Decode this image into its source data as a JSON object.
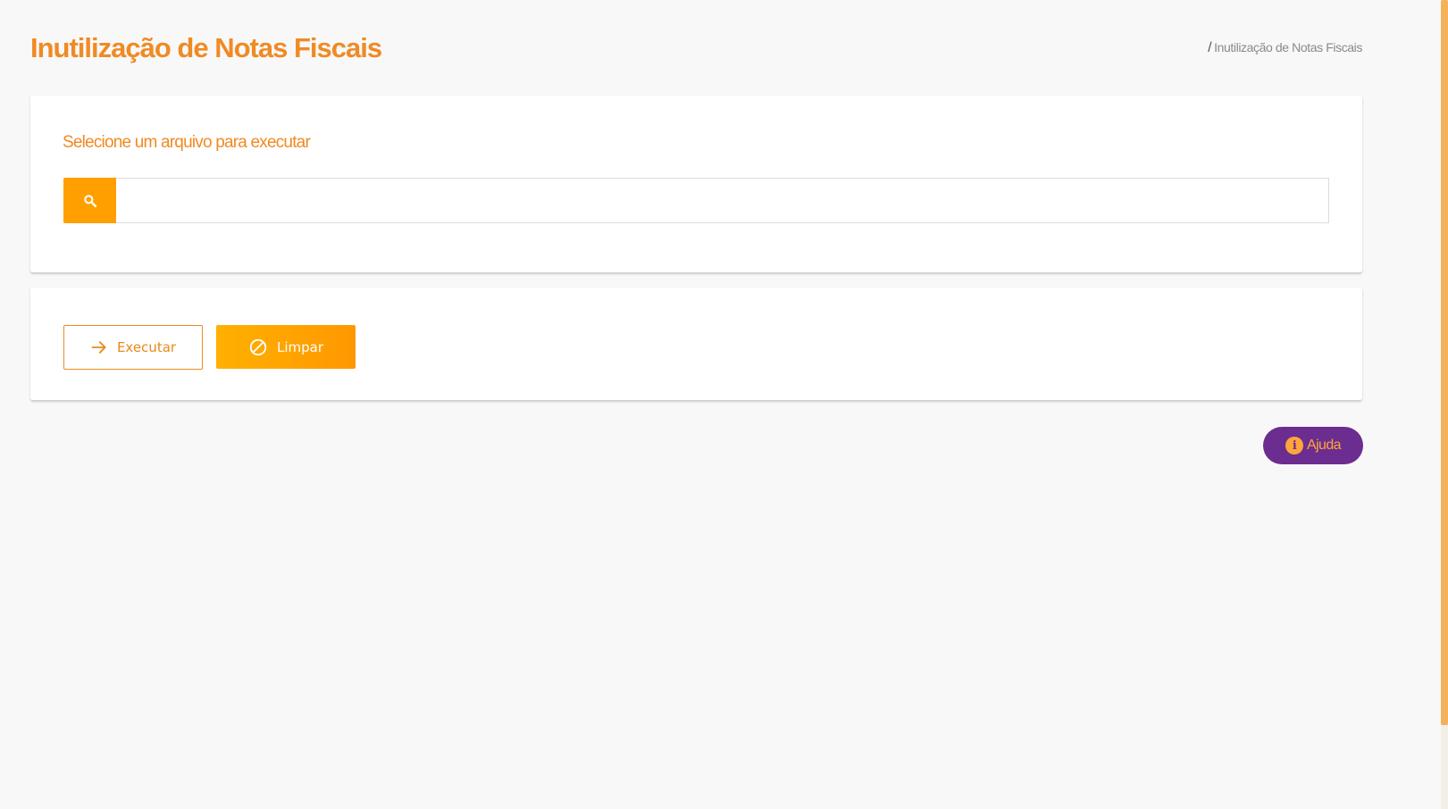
{
  "header": {
    "title": "Inutilização de Notas Fiscais",
    "breadcrumb_sep": "/",
    "breadcrumb_current": "Inutilização de Notas Fiscais"
  },
  "file_card": {
    "subtitle": "Selecione um arquivo para executar",
    "search_icon": "search-icon",
    "file_input_value": "",
    "file_input_placeholder": ""
  },
  "actions": {
    "executar_label": "Executar",
    "executar_icon": "arrow-right-icon",
    "limpar_label": "Limpar",
    "limpar_icon": "block-icon"
  },
  "help": {
    "label": "Ajuda",
    "icon": "info-icon",
    "icon_glyph": "i"
  },
  "colors": {
    "accent": "#f08a24",
    "button_orange": "#ffa000",
    "help_purple": "#6b2d8f",
    "background": "#f8f8f8"
  }
}
